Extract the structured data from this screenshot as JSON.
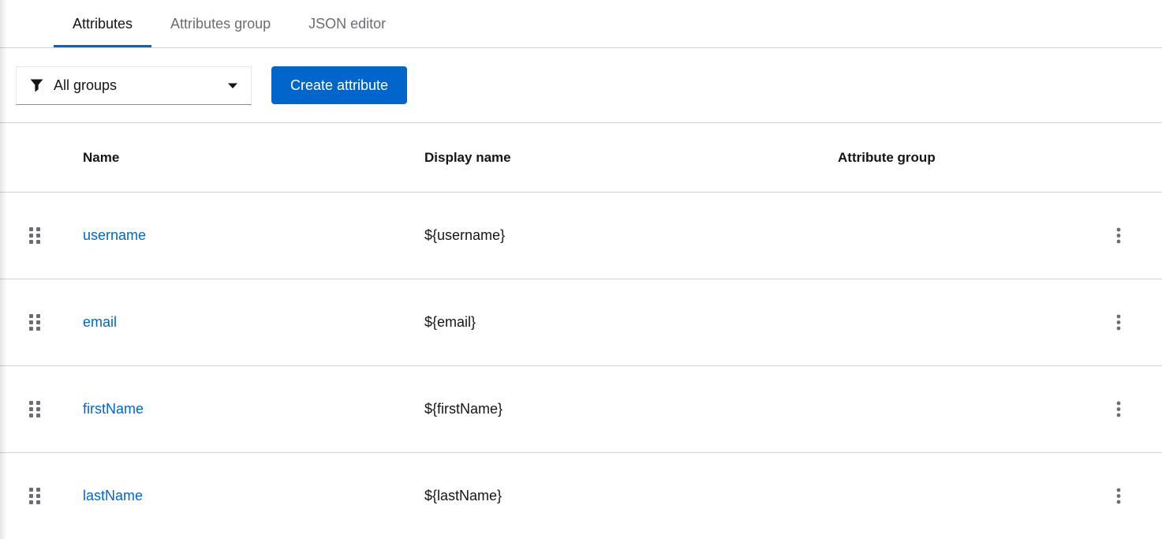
{
  "tabs": [
    {
      "label": "Attributes",
      "active": true
    },
    {
      "label": "Attributes group",
      "active": false
    },
    {
      "label": "JSON editor",
      "active": false
    }
  ],
  "toolbar": {
    "filter_selected": "All groups",
    "create_button_label": "Create attribute"
  },
  "table": {
    "headers": {
      "name": "Name",
      "display_name": "Display name",
      "attribute_group": "Attribute group"
    },
    "rows": [
      {
        "name": "username",
        "display_name": "${username}",
        "attribute_group": ""
      },
      {
        "name": "email",
        "display_name": "${email}",
        "attribute_group": ""
      },
      {
        "name": "firstName",
        "display_name": "${firstName}",
        "attribute_group": ""
      },
      {
        "name": "lastName",
        "display_name": "${lastName}",
        "attribute_group": ""
      }
    ]
  },
  "icons": {
    "filter": "filter-funnel",
    "caret": "chevron-down",
    "drag": "grip-vertical",
    "kebab": "three-dot-menu"
  },
  "colors": {
    "accent": "#0066cc",
    "link": "#0066cc",
    "text": "#151515",
    "muted_text": "#6a6e73",
    "border": "#d2d2d2",
    "button_bg": "#0066cc",
    "button_text": "#ffffff"
  }
}
